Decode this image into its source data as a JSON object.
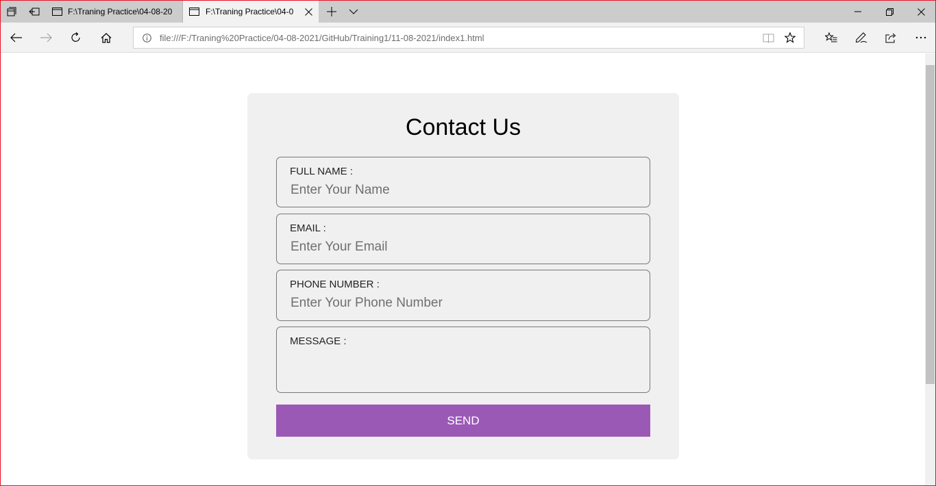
{
  "browser": {
    "tabs": [
      {
        "title": "F:\\Traning Practice\\04-08-20"
      },
      {
        "title": "F:\\Traning Practice\\04-0"
      }
    ],
    "address": "file:///F:/Traning%20Practice/04-08-2021/GitHub/Training1/11-08-2021/index1.html"
  },
  "icons": {
    "tab_manager": "tab-manager-icon",
    "set_aside": "set-aside-tabs-icon",
    "page": "page-icon",
    "close": "close-icon",
    "new_tab": "plus-icon",
    "tab_list": "chevron-down-icon",
    "minimize": "minimize-icon",
    "restore": "restore-icon",
    "window_close": "window-close-icon",
    "back": "back-arrow-icon",
    "forward": "forward-arrow-icon",
    "refresh": "refresh-icon",
    "home": "home-icon",
    "info": "info-icon",
    "reading_view": "reading-view-icon",
    "favorite": "star-icon",
    "favorites": "favorites-list-icon",
    "notes": "pen-icon",
    "share": "share-icon",
    "more": "more-icon"
  },
  "form": {
    "title": "Contact Us",
    "fields": [
      {
        "label": "FULL NAME :",
        "placeholder": "Enter Your Name",
        "value": ""
      },
      {
        "label": "EMAIL :",
        "placeholder": "Enter Your Email",
        "value": ""
      },
      {
        "label": "PHONE NUMBER :",
        "placeholder": "Enter Your Phone Number",
        "value": ""
      },
      {
        "label": "MESSAGE :",
        "placeholder": "",
        "value": ""
      }
    ],
    "button": "SEND"
  },
  "colors": {
    "button": "#9b59b6",
    "card": "#f0f0f0",
    "window_border": "#e81123"
  }
}
